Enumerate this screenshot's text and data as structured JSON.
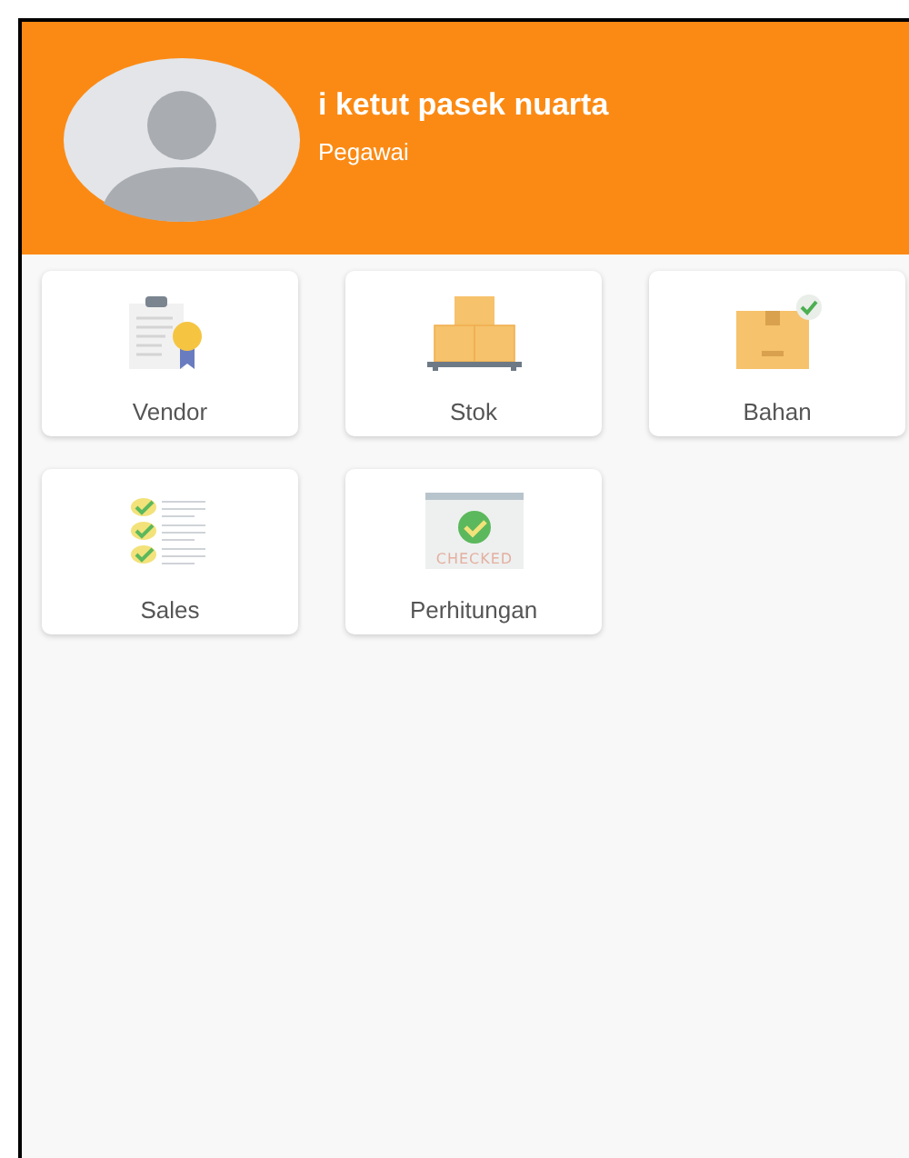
{
  "profile": {
    "name": "i ketut pasek nuarta",
    "role": "Pegawai"
  },
  "menu": [
    {
      "label": "Vendor",
      "kind": "certificate"
    },
    {
      "label": "Stok",
      "kind": "boxes"
    },
    {
      "label": "Bahan",
      "kind": "box"
    },
    {
      "label": "Sales",
      "kind": "checklist"
    },
    {
      "label": "Perhitungan",
      "kind": "checked",
      "stamp": "CHECKED"
    }
  ]
}
